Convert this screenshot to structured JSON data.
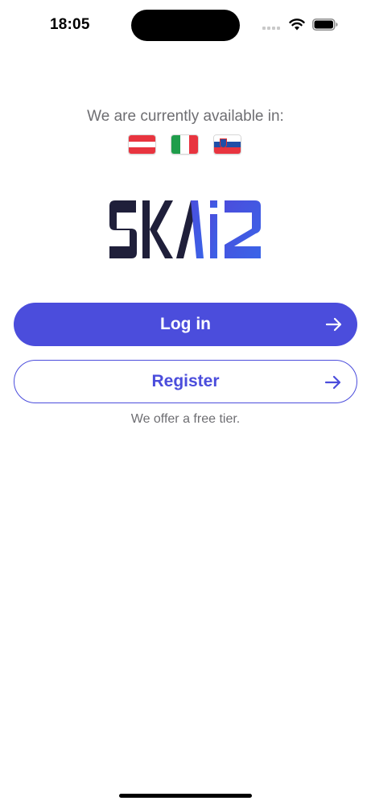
{
  "status_bar": {
    "time": "18:05"
  },
  "availability": {
    "text": "We are currently available in:",
    "flags": [
      {
        "country": "Austria",
        "colors": [
          "#e8343f",
          "#ffffff",
          "#e8343f"
        ]
      },
      {
        "country": "Italy",
        "colors": [
          "#1f9d4b",
          "#ffffff",
          "#e8343f"
        ]
      },
      {
        "country": "Slovenia",
        "colors": [
          "#ffffff",
          "#1f4ea8",
          "#e8343f"
        ]
      }
    ]
  },
  "logo": {
    "text": "SKAi2",
    "colors": {
      "dark": "#1f1f3a",
      "accent": "#4b4ddc"
    }
  },
  "buttons": {
    "login_label": "Log in",
    "register_label": "Register"
  },
  "note": "We offer a free tier.",
  "theme": {
    "accent": "#4b4ddc",
    "muted_text": "#6e6e72"
  }
}
